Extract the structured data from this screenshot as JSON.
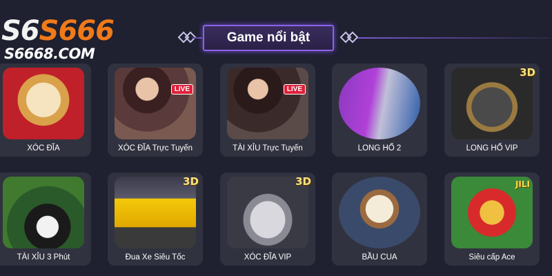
{
  "logo": {
    "mark_part1": "S6",
    "mark_part2": "S666",
    "url": "S6668.COM"
  },
  "section": {
    "title": "Game nổi bật"
  },
  "games": [
    {
      "label": "XÓC ĐĨA"
    },
    {
      "label": "XÓC ĐĨA Trực Tuyến",
      "badge": "LIVE"
    },
    {
      "label": "TÀI XỈU Trực Tuyến",
      "badge": "LIVE"
    },
    {
      "label": "LONG HỔ 2"
    },
    {
      "label": "LONG HỔ VIP",
      "badge": "3D"
    },
    {
      "label": "TÀI XỈU 3 Phút"
    },
    {
      "label": "Đua Xe Siêu Tốc",
      "badge": "3D"
    },
    {
      "label": "XÓC ĐĨA VIP",
      "badge": "3D"
    },
    {
      "label": "BẦU CUA"
    },
    {
      "label": "Siêu cấp Ace",
      "badge": "JILI"
    }
  ],
  "colors": {
    "background": "#1f2030",
    "card": "#31323f",
    "title_border": "#8b63e6",
    "logo_accent": "#f07a1a"
  }
}
